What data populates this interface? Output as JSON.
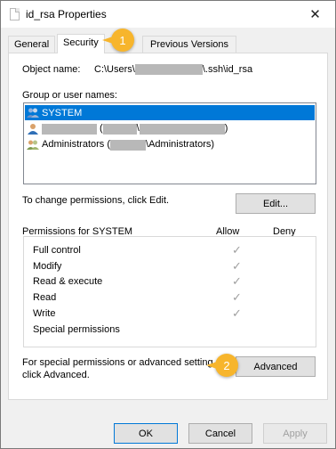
{
  "window": {
    "title": "id_rsa Properties",
    "close_glyph": "✕"
  },
  "tabs": [
    {
      "label": "General"
    },
    {
      "label": "Security",
      "active": true
    },
    {
      "label": "Previous Versions"
    }
  ],
  "object_name": {
    "label": "Object name:",
    "prefix": "C:\\Users\\",
    "suffix": "\\.ssh\\id_rsa"
  },
  "groups": {
    "label": "Group or user names:",
    "items": [
      {
        "label": "SYSTEM",
        "selected": true,
        "icon": "users-group-icon"
      },
      {
        "label": "(\\)",
        "icon": "user-icon"
      },
      {
        "label_prefix": "Administrators (",
        "label_suffix": "\\Administrators)",
        "icon": "users-group-icon"
      }
    ]
  },
  "change_hint": "To change permissions, click Edit.",
  "edit_label": "Edit...",
  "permissions": {
    "title": "Permissions for SYSTEM",
    "allow_header": "Allow",
    "deny_header": "Deny",
    "rows": [
      {
        "name": "Full control",
        "allow": true
      },
      {
        "name": "Modify",
        "allow": true
      },
      {
        "name": "Read & execute",
        "allow": true
      },
      {
        "name": "Read",
        "allow": true
      },
      {
        "name": "Write",
        "allow": true
      },
      {
        "name": "Special permissions",
        "allow": false
      }
    ],
    "check_glyph": "✓"
  },
  "advanced_hint": {
    "line1": "For special permissions or advanced setting",
    "line2": "click Advanced."
  },
  "advanced_label": "Advanced",
  "annotations": {
    "badge1": "1",
    "badge2": "2",
    "color": "#f7b52c"
  },
  "footer": {
    "ok": "OK",
    "cancel": "Cancel",
    "apply": "Apply"
  }
}
